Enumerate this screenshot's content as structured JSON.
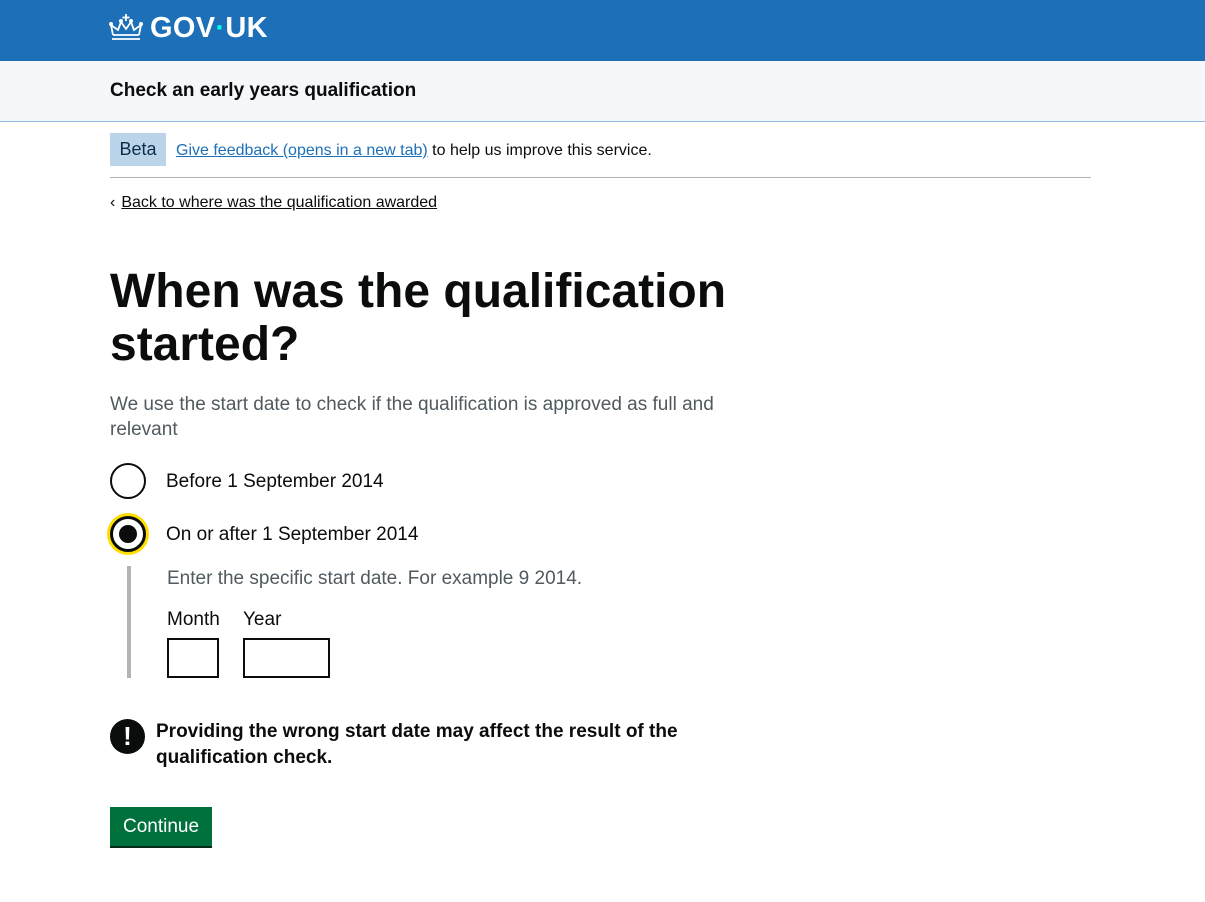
{
  "header": {
    "logo_text": "GOV",
    "logo_text_2": "UK",
    "logo_dot": "·",
    "logo_icon": "crown-icon",
    "brand_color": "#1d70b8"
  },
  "service": {
    "name": "Check an early years qualification"
  },
  "phase_banner": {
    "tag": "Beta",
    "link_text": "Give feedback (opens in a new tab)",
    "suffix": "to help us improve this service."
  },
  "back_link": {
    "label": "Back to where was the qualification awarded"
  },
  "question": {
    "title": "When was the qualification started?",
    "hint": "We use the start date to check if the qualification is approved as full and relevant"
  },
  "options": [
    {
      "label": "Before 1 September 2014",
      "checked": false
    },
    {
      "label": "On or after 1 September 2014",
      "checked": true
    }
  ],
  "conditional": {
    "hint": "Enter the specific start date. For example 9 2014.",
    "month_label": "Month",
    "year_label": "Year",
    "month_value": "",
    "year_value": ""
  },
  "warning": {
    "icon": "!",
    "text": "Providing the wrong start date may affect the result of the qualification check."
  },
  "actions": {
    "continue_label": "Continue",
    "button_color": "#00703c"
  }
}
